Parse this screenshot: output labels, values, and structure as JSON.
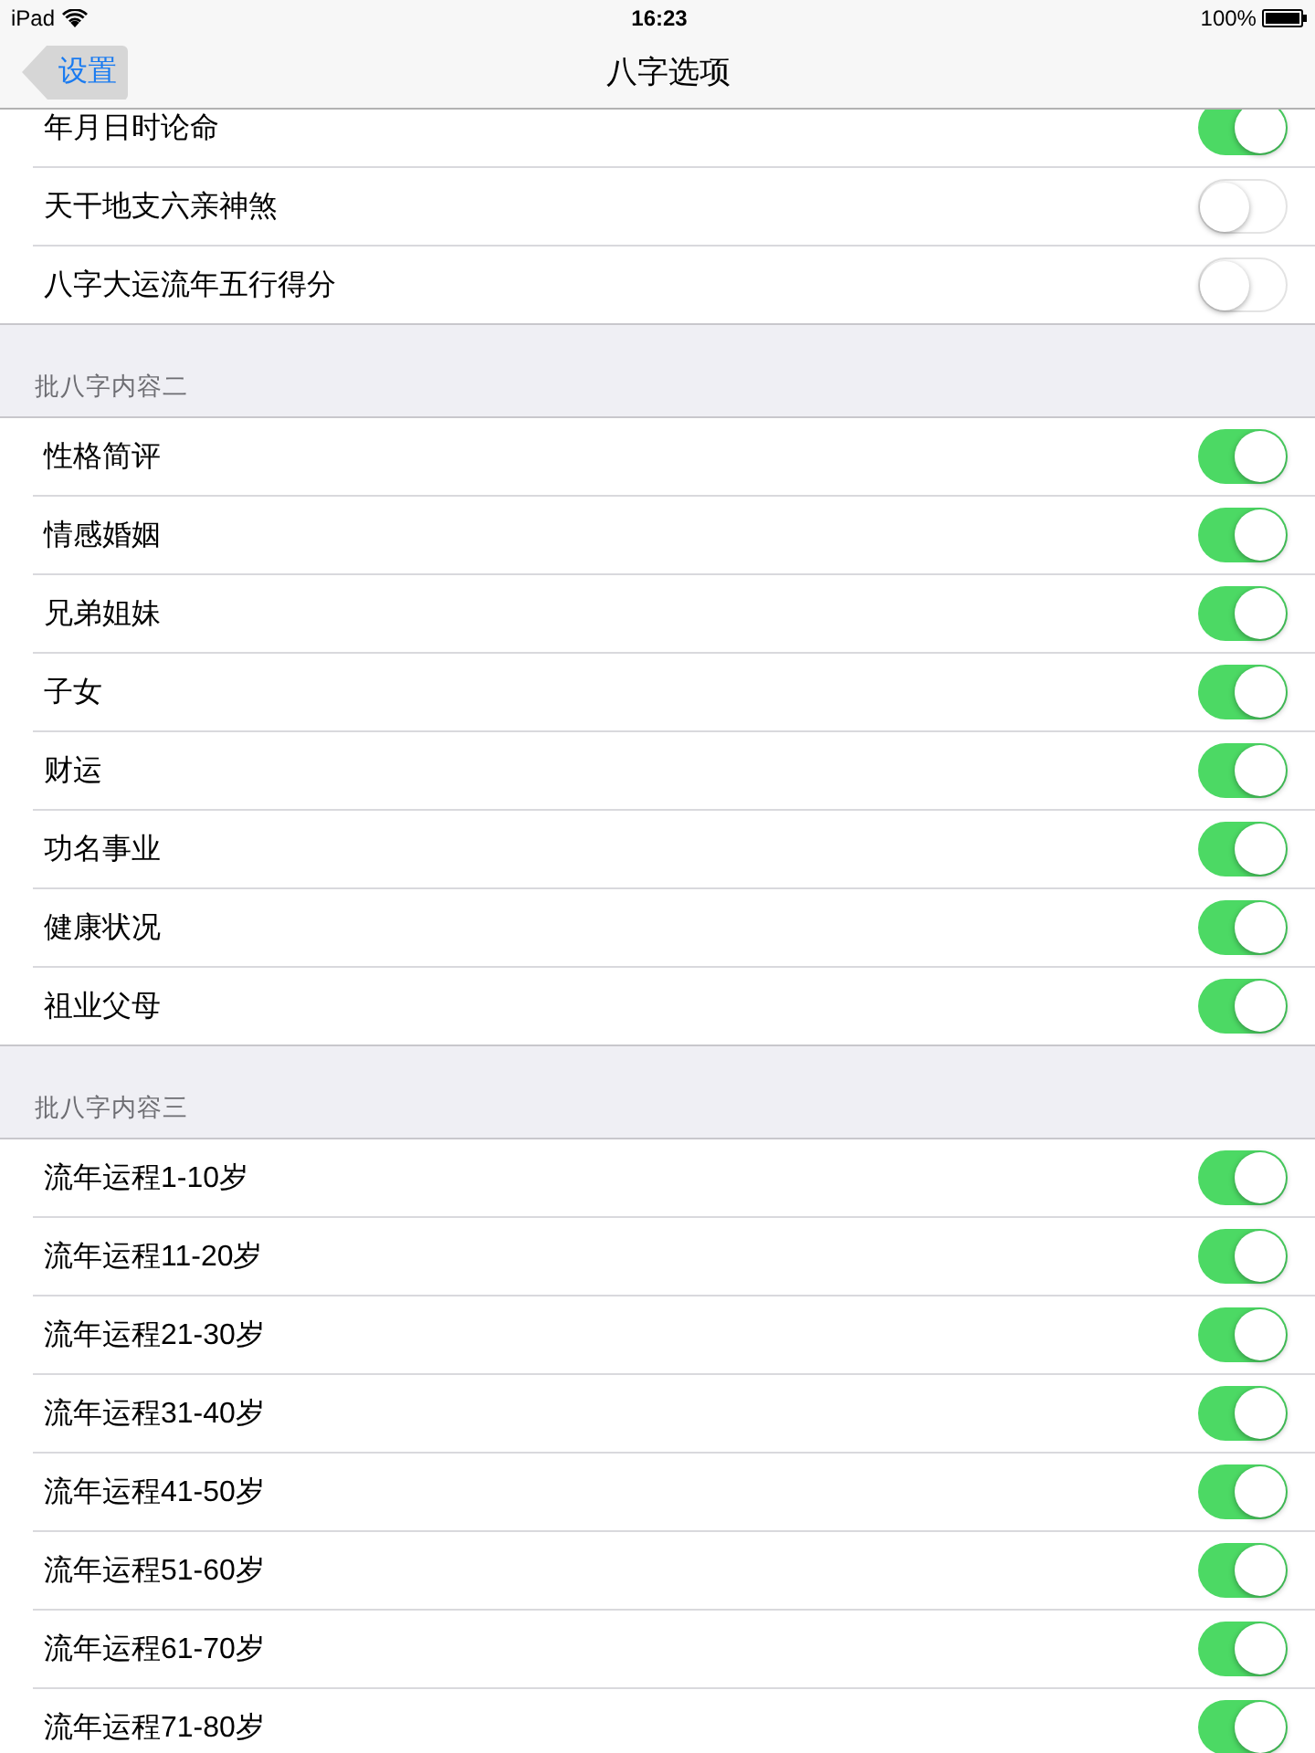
{
  "status_bar": {
    "device": "iPad",
    "time": "16:23",
    "battery": "100%"
  },
  "nav_bar": {
    "back": {
      "label": "设置",
      "pressed": true
    },
    "title": "八字选项"
  },
  "sections": [
    {
      "rows": [
        {
          "label": "年月日时论命",
          "on": true
        },
        {
          "label": "天干地支六亲神煞",
          "on": false
        },
        {
          "label": "八字大运流年五行得分",
          "on": false
        }
      ]
    },
    {
      "header": "批八字内容二",
      "rows": [
        {
          "label": "性格简评",
          "on": true
        },
        {
          "label": "情感婚姻",
          "on": true
        },
        {
          "label": "兄弟姐妹",
          "on": true
        },
        {
          "label": "子女",
          "on": true
        },
        {
          "label": "财运",
          "on": true
        },
        {
          "label": "功名事业",
          "on": true
        },
        {
          "label": "健康状况",
          "on": true
        },
        {
          "label": "祖业父母",
          "on": true
        }
      ]
    },
    {
      "header": "批八字内容三",
      "rows": [
        {
          "label": "流年运程1-10岁",
          "on": true
        },
        {
          "label": "流年运程11-20岁",
          "on": true
        },
        {
          "label": "流年运程21-30岁",
          "on": true
        },
        {
          "label": "流年运程31-40岁",
          "on": true
        },
        {
          "label": "流年运程41-50岁",
          "on": true
        },
        {
          "label": "流年运程51-60岁",
          "on": true
        },
        {
          "label": "流年运程61-70岁",
          "on": true
        },
        {
          "label": "流年运程71-80岁",
          "on": true
        }
      ]
    }
  ]
}
